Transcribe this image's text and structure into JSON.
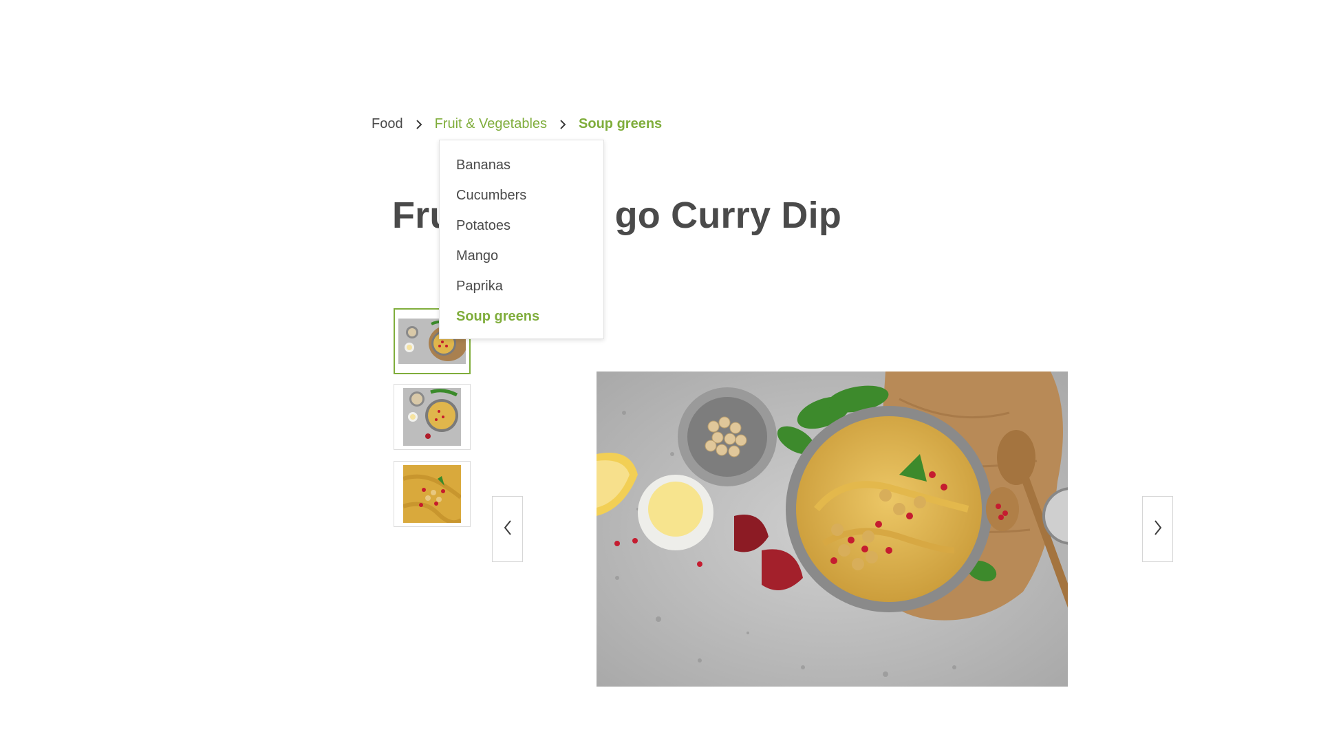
{
  "breadcrumb": {
    "items": [
      {
        "label": "Food"
      },
      {
        "label": "Fruit & Vegetables"
      },
      {
        "label": "Soup greens"
      }
    ]
  },
  "dropdown": {
    "items": [
      {
        "label": "Bananas"
      },
      {
        "label": "Cucumbers"
      },
      {
        "label": "Potatoes"
      },
      {
        "label": "Mango"
      },
      {
        "label": "Paprika"
      },
      {
        "label": "Soup greens",
        "active": true
      }
    ]
  },
  "product": {
    "title_visible_start": "Fru",
    "title_visible_end": "go Curry Dip"
  },
  "gallery": {
    "thumbnails": [
      {
        "alt": "hummus bowl with lemon and chickpeas",
        "selected": true
      },
      {
        "alt": "hummus bowl top view",
        "selected": false
      },
      {
        "alt": "hummus close-up with pomegranate",
        "selected": false
      }
    ],
    "main_image_alt": "hummus dip with chickpeas, pomegranate, lemon and parsley on wooden board",
    "prev_icon": "chevron-left-icon",
    "next_icon": "chevron-right-icon"
  },
  "colors": {
    "accent": "#7fad3b",
    "text": "#4a4a4a",
    "border": "#dcdcdc"
  }
}
